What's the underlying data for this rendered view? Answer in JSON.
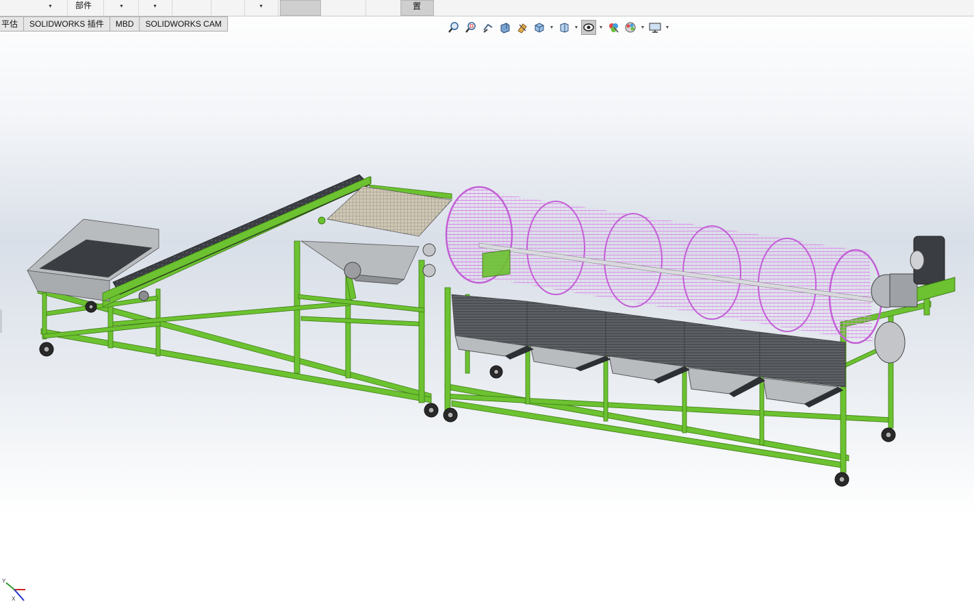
{
  "ribbon": {
    "labels": [
      "部件",
      "置"
    ]
  },
  "tabs": [
    {
      "label": "平估"
    },
    {
      "label": "SOLIDWORKS 插件"
    },
    {
      "label": "MBD"
    },
    {
      "label": "SOLIDWORKS CAM"
    }
  ],
  "view_toolbar": {
    "icons": [
      "zoom-to-fit-icon",
      "zoom-to-area-icon",
      "previous-view-icon",
      "section-view-icon",
      "dynamic-annotation-icon",
      "view-orientation-icon",
      "display-style-icon",
      "hide-show-items-icon",
      "edit-appearance-icon",
      "apply-scene-icon",
      "view-settings-icon"
    ]
  },
  "triad": {
    "y_label": "Y",
    "x_label": "X"
  },
  "colors": {
    "frame_green": "#6cc230",
    "drum_mesh_pink": "#d77ee6",
    "belt_dark": "#3a3d42",
    "sheet_metal": "#b9bcbf",
    "active_button": "#c9c9c9"
  }
}
